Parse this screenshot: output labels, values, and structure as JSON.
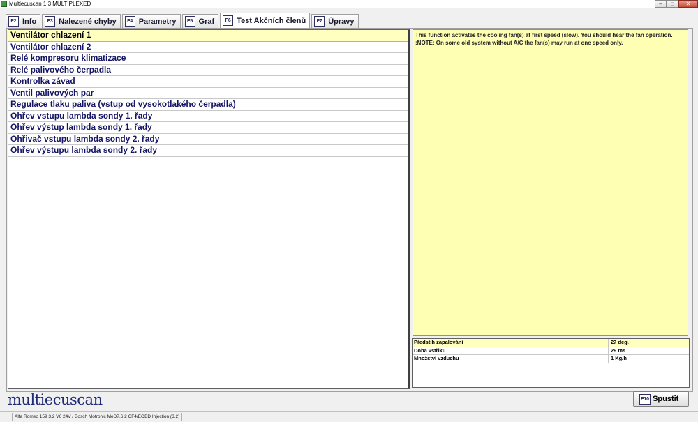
{
  "window": {
    "title": "Multiecuscan 1.3 MULTIPLEXED",
    "controls": {
      "minimize": "–",
      "maximize": "□",
      "close": "✕"
    }
  },
  "tabs": [
    {
      "key": "F2",
      "label": "Info"
    },
    {
      "key": "F3",
      "label": "Nalezené chyby"
    },
    {
      "key": "F4",
      "label": "Parametry"
    },
    {
      "key": "F5",
      "label": "Graf"
    },
    {
      "key": "F6",
      "label": "Test Akčních členů",
      "active": true
    },
    {
      "key": "F7",
      "label": "Úpravy"
    }
  ],
  "actuators": [
    "Ventilátor chlazení 1",
    "Ventilátor chlazení 2",
    "Relé kompresoru klimatizace",
    "Relé palivového čerpadla",
    "Kontrolka závad",
    "Ventil palivových par",
    "Regulace tlaku paliva (vstup od vysokotlakého čerpadla)",
    "Ohřev vstupu lambda sondy 1. řady",
    "Ohřev výstup lambda sondy 1. řady",
    "Ohřivač vstupu lambda sondy 2. řady",
    "Ohřev výstupu lambda sondy 2. řady"
  ],
  "selected_index": 0,
  "description": {
    "line1": "This function activates the cooling fan(s) at first speed (slow). You should hear the fan operation.",
    "line2": ":NOTE: On some old system without A/C the fan(s) may run at one speed only."
  },
  "parameters": [
    {
      "name": "Předstih zapalování",
      "value": "27 deg."
    },
    {
      "name": "Doba vstřiku",
      "value": "29 ms"
    },
    {
      "name": "Množství vzduchu",
      "value": "1 Kg/h"
    }
  ],
  "logo": "multiecuscan",
  "run_button": {
    "key": "F10",
    "label": "Spustit"
  },
  "status": "Alfa Romeo 159 3.2 V6 24V / Bosch Motronic MeD7.6.2 CF4/EOBD Injection (3.2)"
}
